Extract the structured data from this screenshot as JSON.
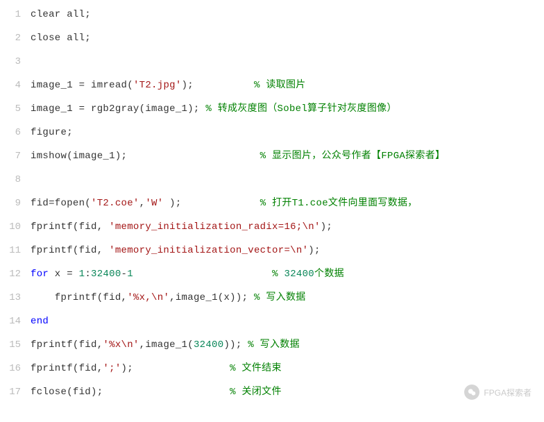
{
  "lines": [
    {
      "no": "1",
      "tokens": [
        {
          "c": "plain",
          "t": "clear all;"
        }
      ]
    },
    {
      "no": "2",
      "tokens": [
        {
          "c": "plain",
          "t": "close all;"
        }
      ]
    },
    {
      "no": "3",
      "tokens": []
    },
    {
      "no": "4",
      "tokens": [
        {
          "c": "plain",
          "t": "image_1 = imread("
        },
        {
          "c": "str",
          "t": "'T2.jpg'"
        },
        {
          "c": "plain",
          "t": ");          "
        },
        {
          "c": "com",
          "t": "% 读取图片"
        }
      ]
    },
    {
      "no": "5",
      "tokens": [
        {
          "c": "plain",
          "t": "image_1 = rgb2gray(image_1); "
        },
        {
          "c": "com",
          "t": "% 转成灰度图（Sobel算子针对灰度图像）"
        }
      ]
    },
    {
      "no": "6",
      "tokens": [
        {
          "c": "plain",
          "t": "figure;"
        }
      ]
    },
    {
      "no": "7",
      "tokens": [
        {
          "c": "plain",
          "t": "imshow(image_1);                      "
        },
        {
          "c": "com",
          "t": "% 显示图片，公众号作者【FPGA探索者】"
        }
      ]
    },
    {
      "no": "8",
      "tokens": []
    },
    {
      "no": "9",
      "tokens": [
        {
          "c": "plain",
          "t": "fid=fopen("
        },
        {
          "c": "str",
          "t": "'T2.coe'"
        },
        {
          "c": "plain",
          "t": ","
        },
        {
          "c": "str",
          "t": "'W' "
        },
        {
          "c": "plain",
          "t": ");             "
        },
        {
          "c": "com",
          "t": "% 打开T1.coe文件向里面写数据，"
        }
      ]
    },
    {
      "no": "10",
      "tokens": [
        {
          "c": "plain",
          "t": "fprintf(fid, "
        },
        {
          "c": "str",
          "t": "'memory_initialization_radix=16;\\n'"
        },
        {
          "c": "plain",
          "t": ");"
        }
      ]
    },
    {
      "no": "11",
      "tokens": [
        {
          "c": "plain",
          "t": "fprintf(fid, "
        },
        {
          "c": "str",
          "t": "'memory_initialization_vector=\\n'"
        },
        {
          "c": "plain",
          "t": ");"
        }
      ]
    },
    {
      "no": "12",
      "tokens": [
        {
          "c": "kw",
          "t": "for"
        },
        {
          "c": "plain",
          "t": " x = "
        },
        {
          "c": "num",
          "t": "1"
        },
        {
          "c": "plain",
          "t": ":"
        },
        {
          "c": "num",
          "t": "32400"
        },
        {
          "c": "plain",
          "t": "-"
        },
        {
          "c": "num",
          "t": "1"
        },
        {
          "c": "plain",
          "t": "                       "
        },
        {
          "c": "com",
          "t": "% "
        },
        {
          "c": "num",
          "t": "32400"
        },
        {
          "c": "com",
          "t": "个数据"
        }
      ]
    },
    {
      "no": "13",
      "tokens": [
        {
          "c": "plain",
          "t": "    fprintf(fid,"
        },
        {
          "c": "str",
          "t": "'%x,\\n'"
        },
        {
          "c": "plain",
          "t": ",image_1(x)); "
        },
        {
          "c": "com",
          "t": "% 写入数据"
        }
      ]
    },
    {
      "no": "14",
      "tokens": [
        {
          "c": "kw",
          "t": "end"
        }
      ]
    },
    {
      "no": "15",
      "tokens": [
        {
          "c": "plain",
          "t": "fprintf(fid,"
        },
        {
          "c": "str",
          "t": "'%x\\n'"
        },
        {
          "c": "plain",
          "t": ",image_1("
        },
        {
          "c": "num",
          "t": "32400"
        },
        {
          "c": "plain",
          "t": ")); "
        },
        {
          "c": "com",
          "t": "% 写入数据"
        }
      ]
    },
    {
      "no": "16",
      "tokens": [
        {
          "c": "plain",
          "t": "fprintf(fid,"
        },
        {
          "c": "str",
          "t": "';'"
        },
        {
          "c": "plain",
          "t": ");                "
        },
        {
          "c": "com",
          "t": "% 文件结束"
        }
      ]
    },
    {
      "no": "17",
      "tokens": [
        {
          "c": "plain",
          "t": "fclose(fid);                     "
        },
        {
          "c": "com",
          "t": "% 关闭文件"
        }
      ]
    }
  ],
  "watermark": {
    "text": "FPGA探索者"
  }
}
